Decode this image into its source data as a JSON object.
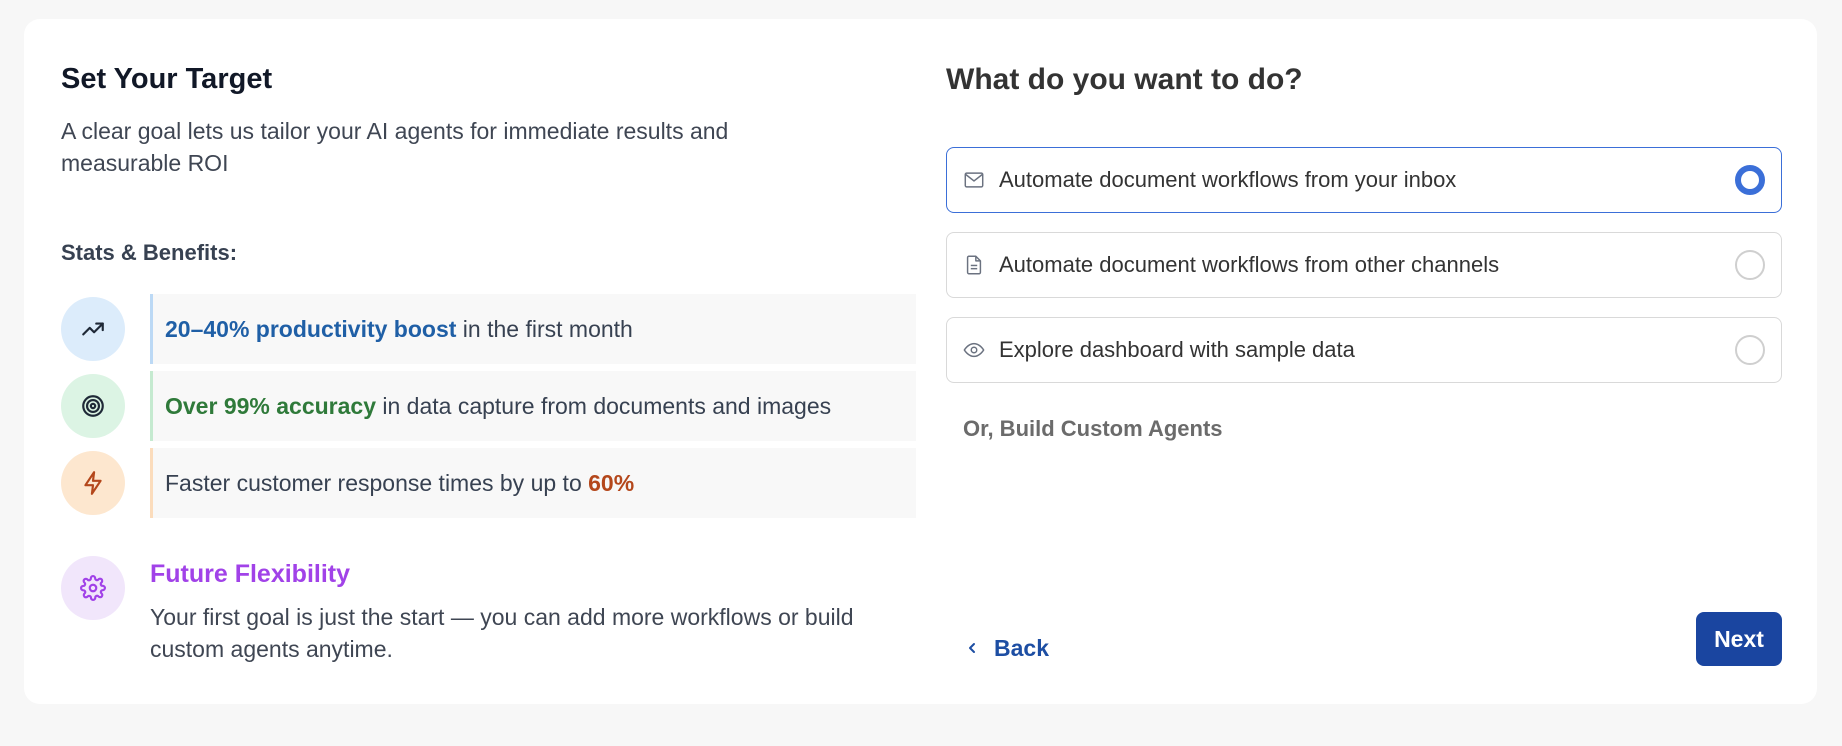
{
  "left": {
    "title": "Set Your Target",
    "subtitle": "A clear goal lets us tailor your AI agents for immediate results and measurable ROI",
    "stats_label": "Stats & Benefits:",
    "stats": [
      {
        "icon": "trending-up-icon",
        "highlight": "20–40% productivity boost",
        "text": " in the first month",
        "color": "#1f5fa6",
        "bg": "#dcecfb",
        "border": "#bcd9f5"
      },
      {
        "icon": "target-icon",
        "highlight": "Over 99% accuracy",
        "text": " in data capture from documents and images",
        "color": "#2f7a3a",
        "bg": "#dcf4e4",
        "border": "#c5ead0"
      },
      {
        "prefix": "Faster customer response times by up to ",
        "icon": "lightning-icon",
        "highlight": "60%",
        "color": "#b4471b",
        "bg": "#fde7cf",
        "border": "#fbdcbc"
      }
    ],
    "flexibility": {
      "icon": "gear-icon",
      "title": "Future Flexibility",
      "description": "Your first goal is just the start — you can add more workflows or build custom agents anytime."
    }
  },
  "right": {
    "question": "What do you want to do?",
    "options": [
      {
        "icon": "mail-icon",
        "label": "Automate document workflows from your inbox",
        "selected": true
      },
      {
        "icon": "document-icon",
        "label": "Automate document workflows from other channels",
        "selected": false
      },
      {
        "icon": "eye-icon",
        "label": "Explore dashboard with sample data",
        "selected": false
      }
    ],
    "custom_link": "Or, Build Custom Agents",
    "back_label": "Back",
    "next_label": "Next"
  },
  "colors": {
    "accent": "#3b6fd8",
    "primary_button": "#1a45a0",
    "purple": "#a142e8"
  }
}
